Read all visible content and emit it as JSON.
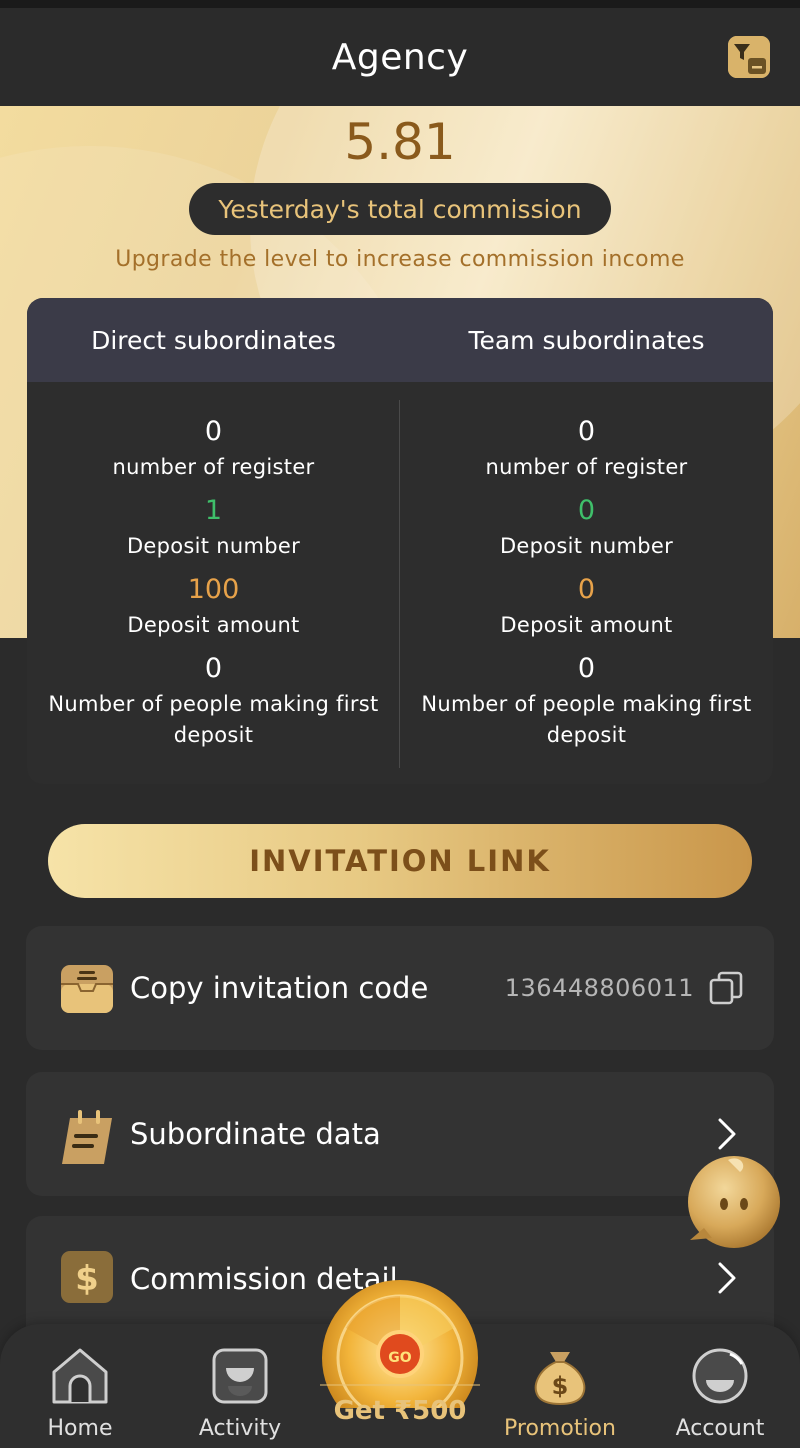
{
  "header": {
    "title": "Agency"
  },
  "hero": {
    "commission_value": "5.81",
    "commission_label": "Yesterday's total commission",
    "upgrade_note": "Upgrade the level to increase commission income"
  },
  "stats": {
    "columns": [
      {
        "title": "Direct subordinates",
        "items": [
          {
            "value": "0",
            "label": "number of register"
          },
          {
            "value": "1",
            "label": "Deposit number"
          },
          {
            "value": "100",
            "label": "Deposit amount"
          },
          {
            "value": "0",
            "label": "Number of people making first deposit"
          }
        ]
      },
      {
        "title": "Team subordinates",
        "items": [
          {
            "value": "0",
            "label": "number of register"
          },
          {
            "value": "0",
            "label": "Deposit number"
          },
          {
            "value": "0",
            "label": "Deposit amount"
          },
          {
            "value": "0",
            "label": "Number of people making first deposit"
          }
        ]
      }
    ]
  },
  "invitation_link_label": "INVITATION LINK",
  "menu": {
    "copy_code": {
      "label": "Copy invitation code",
      "code": "136448806011"
    },
    "subordinate_data": {
      "label": "Subordinate data"
    },
    "commission_detail": {
      "label": "Commission detail"
    }
  },
  "promo": {
    "wheel_label": "GO",
    "get_label": "Get ₹500"
  },
  "bottom_nav": {
    "home": "Home",
    "activity": "Activity",
    "promotion": "Promotion",
    "account": "Account"
  },
  "colors": {
    "gold": "#e8c37a",
    "dark_gold": "#8a5a1c",
    "green": "#3fbf6a",
    "orange": "#e7a24a",
    "background": "#2b2b2b"
  }
}
